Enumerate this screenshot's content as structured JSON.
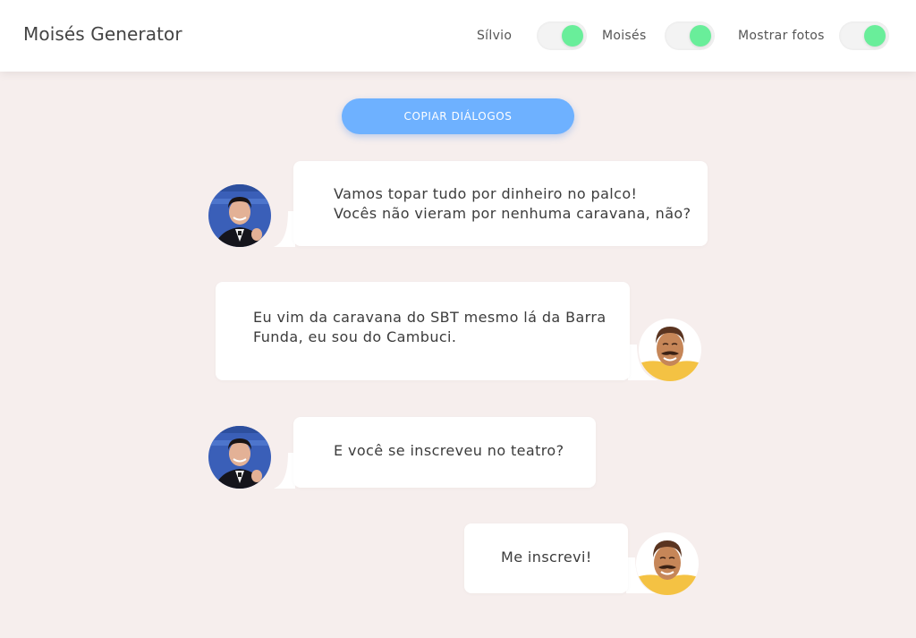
{
  "app": {
    "title": "Moisés Generator"
  },
  "toggles": [
    {
      "label": "Sílvio",
      "on": true
    },
    {
      "label": "Moisés",
      "on": true
    },
    {
      "label": "Mostrar fotos",
      "on": true
    }
  ],
  "copy_button": {
    "label": "COPIAR DIÁLOGOS"
  },
  "messages": [
    {
      "speaker": "Sílvio",
      "text": "Vamos topar tudo por dinheiro no palco!\nVocês não vieram por nenhuma caravana, não?"
    },
    {
      "speaker": "Moisés",
      "text": "Eu vim da caravana do SBT mesmo lá da Barra\nFunda, eu sou do Cambuci."
    },
    {
      "speaker": "Sílvio",
      "text": "E você se inscreveu no teatro?"
    },
    {
      "speaker": "Moisés",
      "text": "Me inscrevi!"
    }
  ],
  "colors": {
    "background": "#f6eeed",
    "toggle_on": "#69ee9a",
    "button": "#6eb1ff"
  }
}
